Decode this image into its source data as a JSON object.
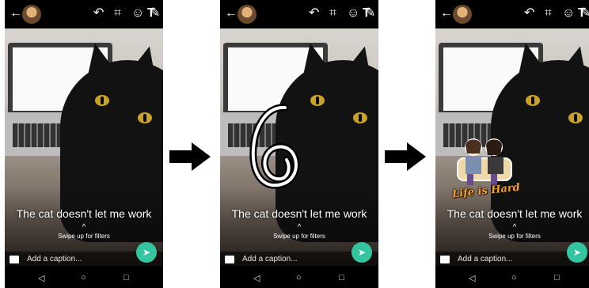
{
  "phones": [
    {
      "overlay_text": "The cat doesn't let me work",
      "swipe_hint": "Swipe up for filters",
      "caption_placeholder": "Add a caption..."
    },
    {
      "overlay_text": "The cat doesn't let me work",
      "swipe_hint": "Swipe up for filters",
      "caption_placeholder": "Add a caption...",
      "drawing": "hand-drawn-6-icon"
    },
    {
      "overlay_text": "The cat doesn't let me work",
      "swipe_hint": "Swipe up for filters",
      "caption_placeholder": "Add a caption...",
      "sticker_text": "Life is Hard"
    }
  ],
  "icons": {
    "back": "arrow-left-icon",
    "undo": "undo-icon",
    "crop": "crop-rotate-icon",
    "emoji": "emoji-icon",
    "text": "text-tool-icon",
    "pen": "pencil-icon",
    "send": "send-icon",
    "gallery": "gallery-icon",
    "nav_back": "nav-back-icon",
    "nav_home": "nav-home-icon",
    "nav_recents": "nav-recents-icon",
    "step_arrow": "right-arrow-icon"
  },
  "colors": {
    "send_button": "#35c4a0",
    "sticker_text": "#f2a233"
  }
}
